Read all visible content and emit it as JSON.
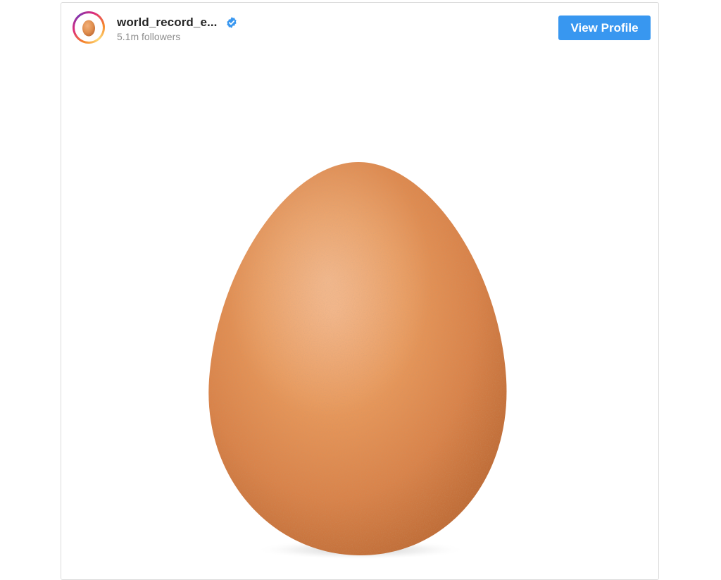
{
  "post": {
    "username": "world_record_e...",
    "followers": "5.1m followers",
    "verified_icon": "verified-badge-icon",
    "view_profile_label": "View Profile",
    "image_subject": "egg",
    "colors": {
      "button": "#3897f0",
      "username": "#262626",
      "followers": "#8e8e8e",
      "egg": "#e0914f",
      "verified": "#3897f0"
    }
  }
}
